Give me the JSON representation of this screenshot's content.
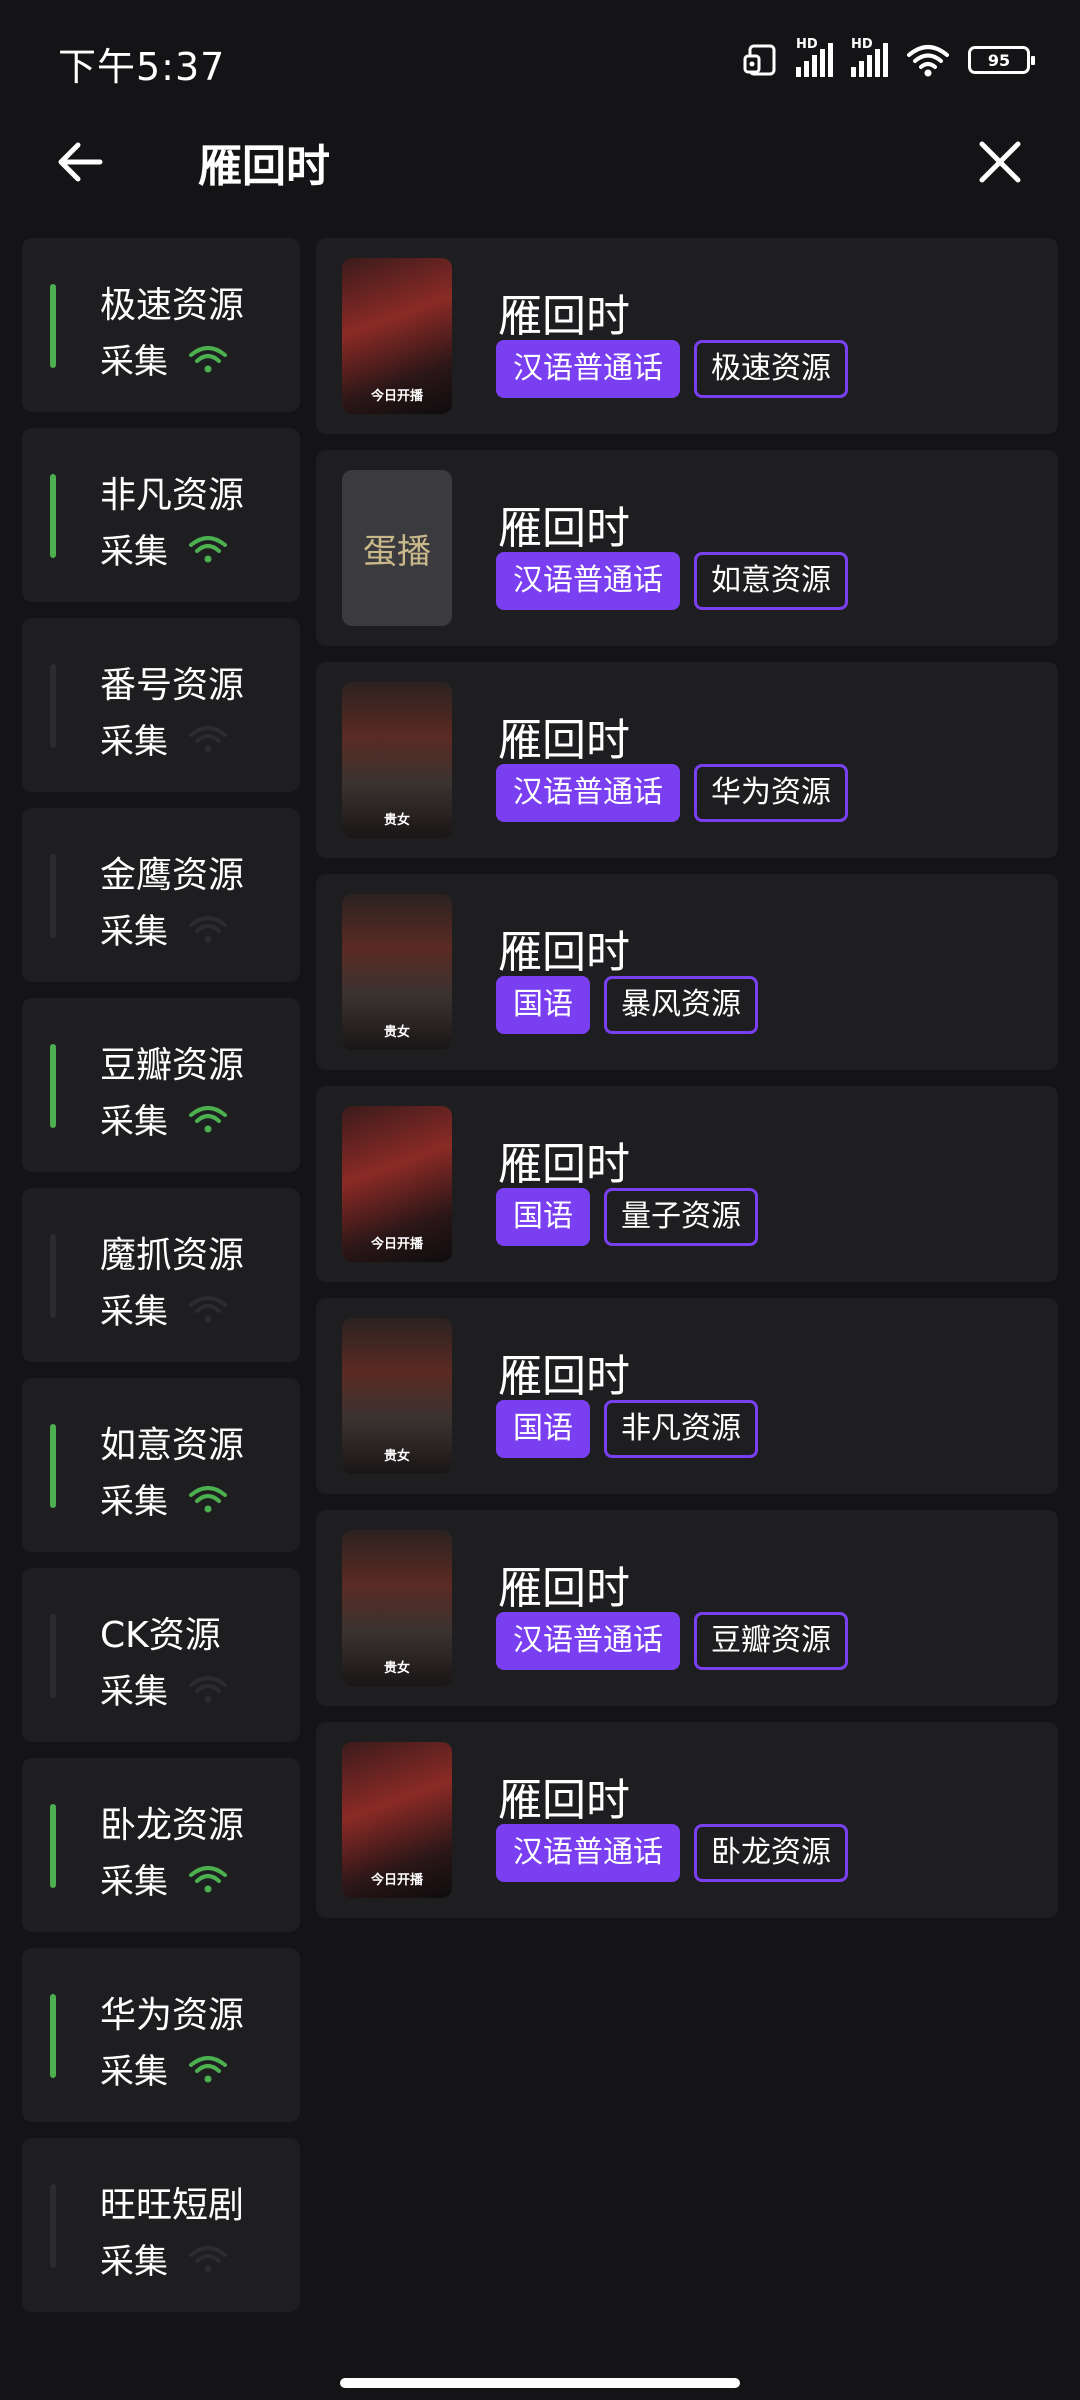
{
  "status": {
    "time": "下午5:37",
    "battery": "95",
    "hd": "HD"
  },
  "header": {
    "title": "雁回时"
  },
  "sidebar": {
    "items": [
      {
        "name": "极速资源",
        "sub": "采集",
        "active": true
      },
      {
        "name": "非凡资源",
        "sub": "采集",
        "active": true
      },
      {
        "name": "番号资源",
        "sub": "采集",
        "active": false
      },
      {
        "name": "金鹰资源",
        "sub": "采集",
        "active": false
      },
      {
        "name": "豆瓣资源",
        "sub": "采集",
        "active": true
      },
      {
        "name": "魔抓资源",
        "sub": "采集",
        "active": false
      },
      {
        "name": "如意资源",
        "sub": "采集",
        "active": true
      },
      {
        "name": "CK资源",
        "sub": "采集",
        "active": false
      },
      {
        "name": "卧龙资源",
        "sub": "采集",
        "active": true
      },
      {
        "name": "华为资源",
        "sub": "采集",
        "active": true
      },
      {
        "name": "旺旺短剧",
        "sub": "采集",
        "active": false
      }
    ]
  },
  "results": [
    {
      "title": "雁回时",
      "lang": "汉语普通话",
      "source": "极速资源",
      "poster": "romance",
      "poster_caption": "今日开播"
    },
    {
      "title": "雁回时",
      "lang": "汉语普通话",
      "source": "如意资源",
      "poster": "logo",
      "poster_caption": "蛋播"
    },
    {
      "title": "雁回时",
      "lang": "汉语普通话",
      "source": "华为资源",
      "poster": "noble",
      "poster_caption": "贵女"
    },
    {
      "title": "雁回时",
      "lang": "国语",
      "source": "暴风资源",
      "poster": "noble",
      "poster_caption": "贵女"
    },
    {
      "title": "雁回时",
      "lang": "国语",
      "source": "量子资源",
      "poster": "romance",
      "poster_caption": "今日开播"
    },
    {
      "title": "雁回时",
      "lang": "国语",
      "source": "非凡资源",
      "poster": "noble",
      "poster_caption": "贵女"
    },
    {
      "title": "雁回时",
      "lang": "汉语普通话",
      "source": "豆瓣资源",
      "poster": "noble",
      "poster_caption": "贵女"
    },
    {
      "title": "雁回时",
      "lang": "汉语普通话",
      "source": "卧龙资源",
      "poster": "romance",
      "poster_caption": "今日开播"
    }
  ],
  "colors": {
    "accent": "#7b3ff2",
    "online": "#4caf50",
    "offline": "#2c2c30"
  }
}
